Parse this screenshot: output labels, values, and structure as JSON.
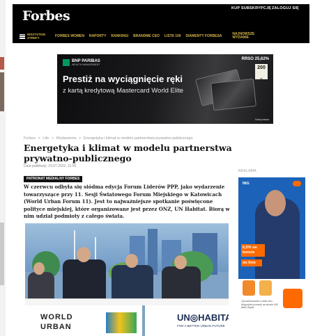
{
  "header": {
    "logo": "Forbes",
    "subscribe_label": "KUP SUBSKRYPCJĘ",
    "login_label": "ZALOGUJ SIĘ",
    "nav_all_label": "WSZYSTKIE STREFY",
    "nav_items": [
      "FORBES WOMEN",
      "RAPORTY",
      "RANKINGI",
      "BRANDME CEO",
      "LISTA 100",
      "DIAMENTY FORBESA"
    ],
    "nav_latest": "NAJNOWSZE WYDANIE",
    "accent_color": "#d8b64a"
  },
  "ad_banner": {
    "bank_name": "BNP PARIBAS",
    "bank_tagline": "WEALTH MANAGEMENT",
    "headline": "Prestiż na wyciągnięcie ręki",
    "subline": "z kartą kredytową Mastercard World Elite",
    "rrso": "RRSO 25,62%",
    "cashback_value": "200",
    "cashback_unit": "zł",
    "note": "Nota prawna"
  },
  "breadcrumb": [
    "Forbes",
    ">",
    "Life",
    ">",
    "Wydarzenia",
    ">",
    "Energetyka i klimat w modelu partnerstwa prywatno-publicznego"
  ],
  "article": {
    "title": "Energetyka i klimat w modelu partnerstwa prywatno-publicznego",
    "pubdate": "Data publikacji: 23.07.2022, 11:06",
    "badge": "PATRONAT MEDIALNY FORBES",
    "lead": "W czerwcu odbyła się siódma edycja Forum Liderów PPP, jako wydarzenie towarzyszące przy 11. Sesji Światowego Forum Miejskiego w Katowicach (World Urban Forum 11). Jest to najważniejsze spotkanie poświęcone polityce miejskiej, które organizowane jest przez ONZ, UN Habitat. Biorą w nim udział podmioty z całego świata."
  },
  "photo": {
    "left_banner_line1": "WORLD",
    "left_banner_line2": "URBAN",
    "right_banner": "UN◎HABITAT",
    "right_banner_sub": "FOR A BETTER URBAN FUTURE"
  },
  "sidebar": {
    "label": "REKLAMA",
    "brand": "ING",
    "promo_rate": "6,5% na koncie",
    "promo_period": "do firm",
    "fine_print": "Oprocentowanie w skali roku. Wygodnie promocji na stronie ING Bank Śląski"
  }
}
